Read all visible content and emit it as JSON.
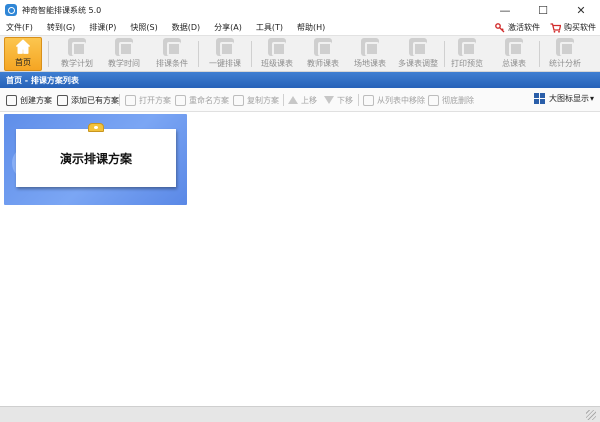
{
  "window": {
    "title": "神奇智能排课系统 5.0",
    "controls": {
      "minimize": "—",
      "maximize": "☐",
      "close": "✕"
    }
  },
  "menubar": {
    "items": [
      "文件(F)",
      "转到(G)",
      "排课(P)",
      "快照(S)",
      "数据(D)",
      "分享(A)",
      "工具(T)",
      "帮助(H)"
    ],
    "activate_label": "激活软件",
    "buy_label": "购买软件"
  },
  "toolbar": {
    "items": [
      {
        "label": "首页",
        "icon": "home-icon",
        "active": true
      },
      {
        "label": "教学计划",
        "icon": "plan-icon"
      },
      {
        "label": "教学时间",
        "icon": "clock-icon"
      },
      {
        "label": "排课条件",
        "icon": "conditions-icon"
      },
      {
        "label": "一键排课",
        "icon": "one-click-icon"
      },
      {
        "label": "班级课表",
        "icon": "class-schedule-icon"
      },
      {
        "label": "教师课表",
        "icon": "teacher-schedule-icon"
      },
      {
        "label": "场地课表",
        "icon": "venue-schedule-icon"
      },
      {
        "label": "多课表调整",
        "icon": "multi-schedule-icon"
      },
      {
        "label": "打印预览",
        "icon": "printer-icon"
      },
      {
        "label": "总课表",
        "icon": "master-schedule-icon"
      },
      {
        "label": "统计分析",
        "icon": "statistics-icon"
      }
    ]
  },
  "section": {
    "title": "首页 - 排课方案列表"
  },
  "actions": [
    {
      "label": "创建方案",
      "enabled": true
    },
    {
      "label": "添加已有方案",
      "enabled": true
    },
    {
      "label": "打开方案",
      "enabled": false
    },
    {
      "label": "重命名方案",
      "enabled": false
    },
    {
      "label": "复制方案",
      "enabled": false
    },
    {
      "label": "上移",
      "enabled": false
    },
    {
      "label": "下移",
      "enabled": false
    },
    {
      "label": "从列表中移除",
      "enabled": false
    },
    {
      "label": "彻底删除",
      "enabled": false
    }
  ],
  "view_mode": {
    "label": "大图标显示"
  },
  "plans": [
    {
      "name": "演示排课方案"
    }
  ],
  "colors": {
    "accent": "#2d6cc5",
    "active_tool": "#f7b233",
    "card_bg": "#6b9af0"
  }
}
